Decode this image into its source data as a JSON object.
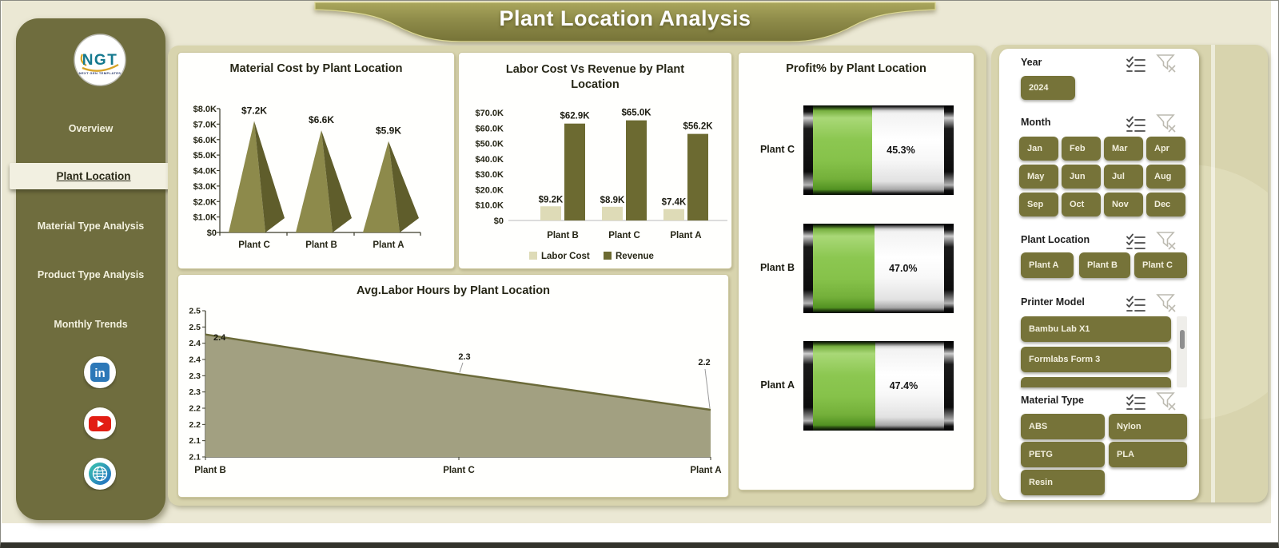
{
  "app": {
    "title": "Plant Location Analysis"
  },
  "logo": {
    "abbr": "NGT",
    "subtitle": "NEXT GEN TEMPLATES"
  },
  "sidebar": {
    "items": [
      {
        "label": "Overview",
        "active": false
      },
      {
        "label": "Plant Location",
        "active": true
      },
      {
        "label": "Material Type Analysis",
        "active": false
      },
      {
        "label": "Product Type Analysis",
        "active": false
      },
      {
        "label": "Monthly Trends",
        "active": false
      }
    ],
    "social": [
      {
        "name": "linkedin"
      },
      {
        "name": "youtube"
      },
      {
        "name": "website"
      }
    ]
  },
  "colors": {
    "canvas": "#ebe8d4",
    "container_khaki": "#d8d4ae",
    "sidebar_olive": "#6f6d3e",
    "button_olive": "#767339",
    "banner_top": "#a9a65c",
    "banner_bottom": "#767337",
    "pyramid_front": "#8d8a4b",
    "pyramid_side": "#5f5d2b",
    "labor_bar": "#dedbb7",
    "revenue_bar": "#6c6a31",
    "area_fill": "#a2a081",
    "area_line": "#6b6a39",
    "profit_green": "#8cc751",
    "text_dark": "#262616"
  },
  "chart_data": [
    {
      "id": "material_cost",
      "type": "bar",
      "variant": "pyramid-3d",
      "title": "Material Cost by Plant Location",
      "categories": [
        "Plant C",
        "Plant B",
        "Plant A"
      ],
      "values": [
        7200,
        6600,
        5900
      ],
      "value_labels": [
        "$7.2K",
        "$6.6K",
        "$5.9K"
      ],
      "y_ticks": [
        "$0",
        "$1.0K",
        "$2.0K",
        "$3.0K",
        "$4.0K",
        "$5.0K",
        "$6.0K",
        "$7.0K",
        "$8.0K"
      ],
      "ylim": [
        0,
        8000
      ],
      "grid": false,
      "legend_position": "none"
    },
    {
      "id": "labor_vs_revenue",
      "type": "bar",
      "title": "Labor Cost Vs Revenue by Plant Location",
      "title_lines": [
        "Labor Cost Vs Revenue  by Plant",
        "Location"
      ],
      "categories": [
        "Plant B",
        "Plant C",
        "Plant A"
      ],
      "series": [
        {
          "name": "Labor Cost",
          "color": "#dedbb7",
          "values": [
            9200,
            8900,
            7400
          ],
          "value_labels": [
            "$9.2K",
            "$8.9K",
            "$7.4K"
          ]
        },
        {
          "name": "Revenue",
          "color": "#6c6a31",
          "values": [
            62900,
            65000,
            56200
          ],
          "value_labels": [
            "$62.9K",
            "$65.0K",
            "$56.2K"
          ]
        }
      ],
      "y_ticks": [
        "$0",
        "$10.0K",
        "$20.0K",
        "$30.0K",
        "$40.0K",
        "$50.0K",
        "$60.0K",
        "$70.0K"
      ],
      "ylim": [
        0,
        70000
      ],
      "grid": false,
      "legend_position": "bottom"
    },
    {
      "id": "profit_pct",
      "type": "bar",
      "variant": "horizontal-cylinder",
      "title": "Profit% by Plant Location",
      "categories": [
        "Plant C",
        "Plant B",
        "Plant A"
      ],
      "values": [
        45.3,
        47.0,
        47.4
      ],
      "value_labels": [
        "45.3%",
        "47.0%",
        "47.4%"
      ],
      "xlim": [
        0,
        100
      ],
      "grid": false,
      "legend_position": "none"
    },
    {
      "id": "avg_labor_hours",
      "type": "area",
      "title": "Avg.Labor Hours by Plant Location",
      "categories": [
        "Plant B",
        "Plant C",
        "Plant A"
      ],
      "values": [
        2.4,
        2.3,
        2.2
      ],
      "value_labels": [
        "2.4",
        "2.3",
        "2.2"
      ],
      "plot_values": [
        2.452,
        2.33,
        2.22
      ],
      "y_ticks": [
        "2.1",
        "2.1",
        "2.2",
        "2.2",
        "2.3",
        "2.3",
        "2.4",
        "2.4",
        "2.5",
        "2.5"
      ],
      "ylim": [
        2.075,
        2.525
      ],
      "grid": false,
      "legend_position": "none"
    }
  ],
  "filters": {
    "header_icons": [
      "multi-select",
      "clear-filter"
    ],
    "sections": [
      {
        "label": "Year",
        "layout": "single",
        "options": [
          "2024"
        ]
      },
      {
        "label": "Month",
        "layout": "grid-4",
        "options": [
          "Jan",
          "Feb",
          "Mar",
          "Apr",
          "May",
          "Jun",
          "Jul",
          "Aug",
          "Sep",
          "Oct",
          "Nov",
          "Dec"
        ]
      },
      {
        "label": "Plant Location",
        "layout": "row-3",
        "options": [
          "Plant A",
          "Plant B",
          "Plant C"
        ]
      },
      {
        "label": "Printer Model",
        "layout": "list",
        "options": [
          "Bambu Lab X1",
          "Formlabs Form 3"
        ],
        "partial_next_option": true,
        "scrollbar": true
      },
      {
        "label": "Material Type",
        "layout": "grid-2",
        "options": [
          "ABS",
          "Nylon",
          "PETG",
          "PLA",
          "Resin"
        ]
      }
    ]
  }
}
